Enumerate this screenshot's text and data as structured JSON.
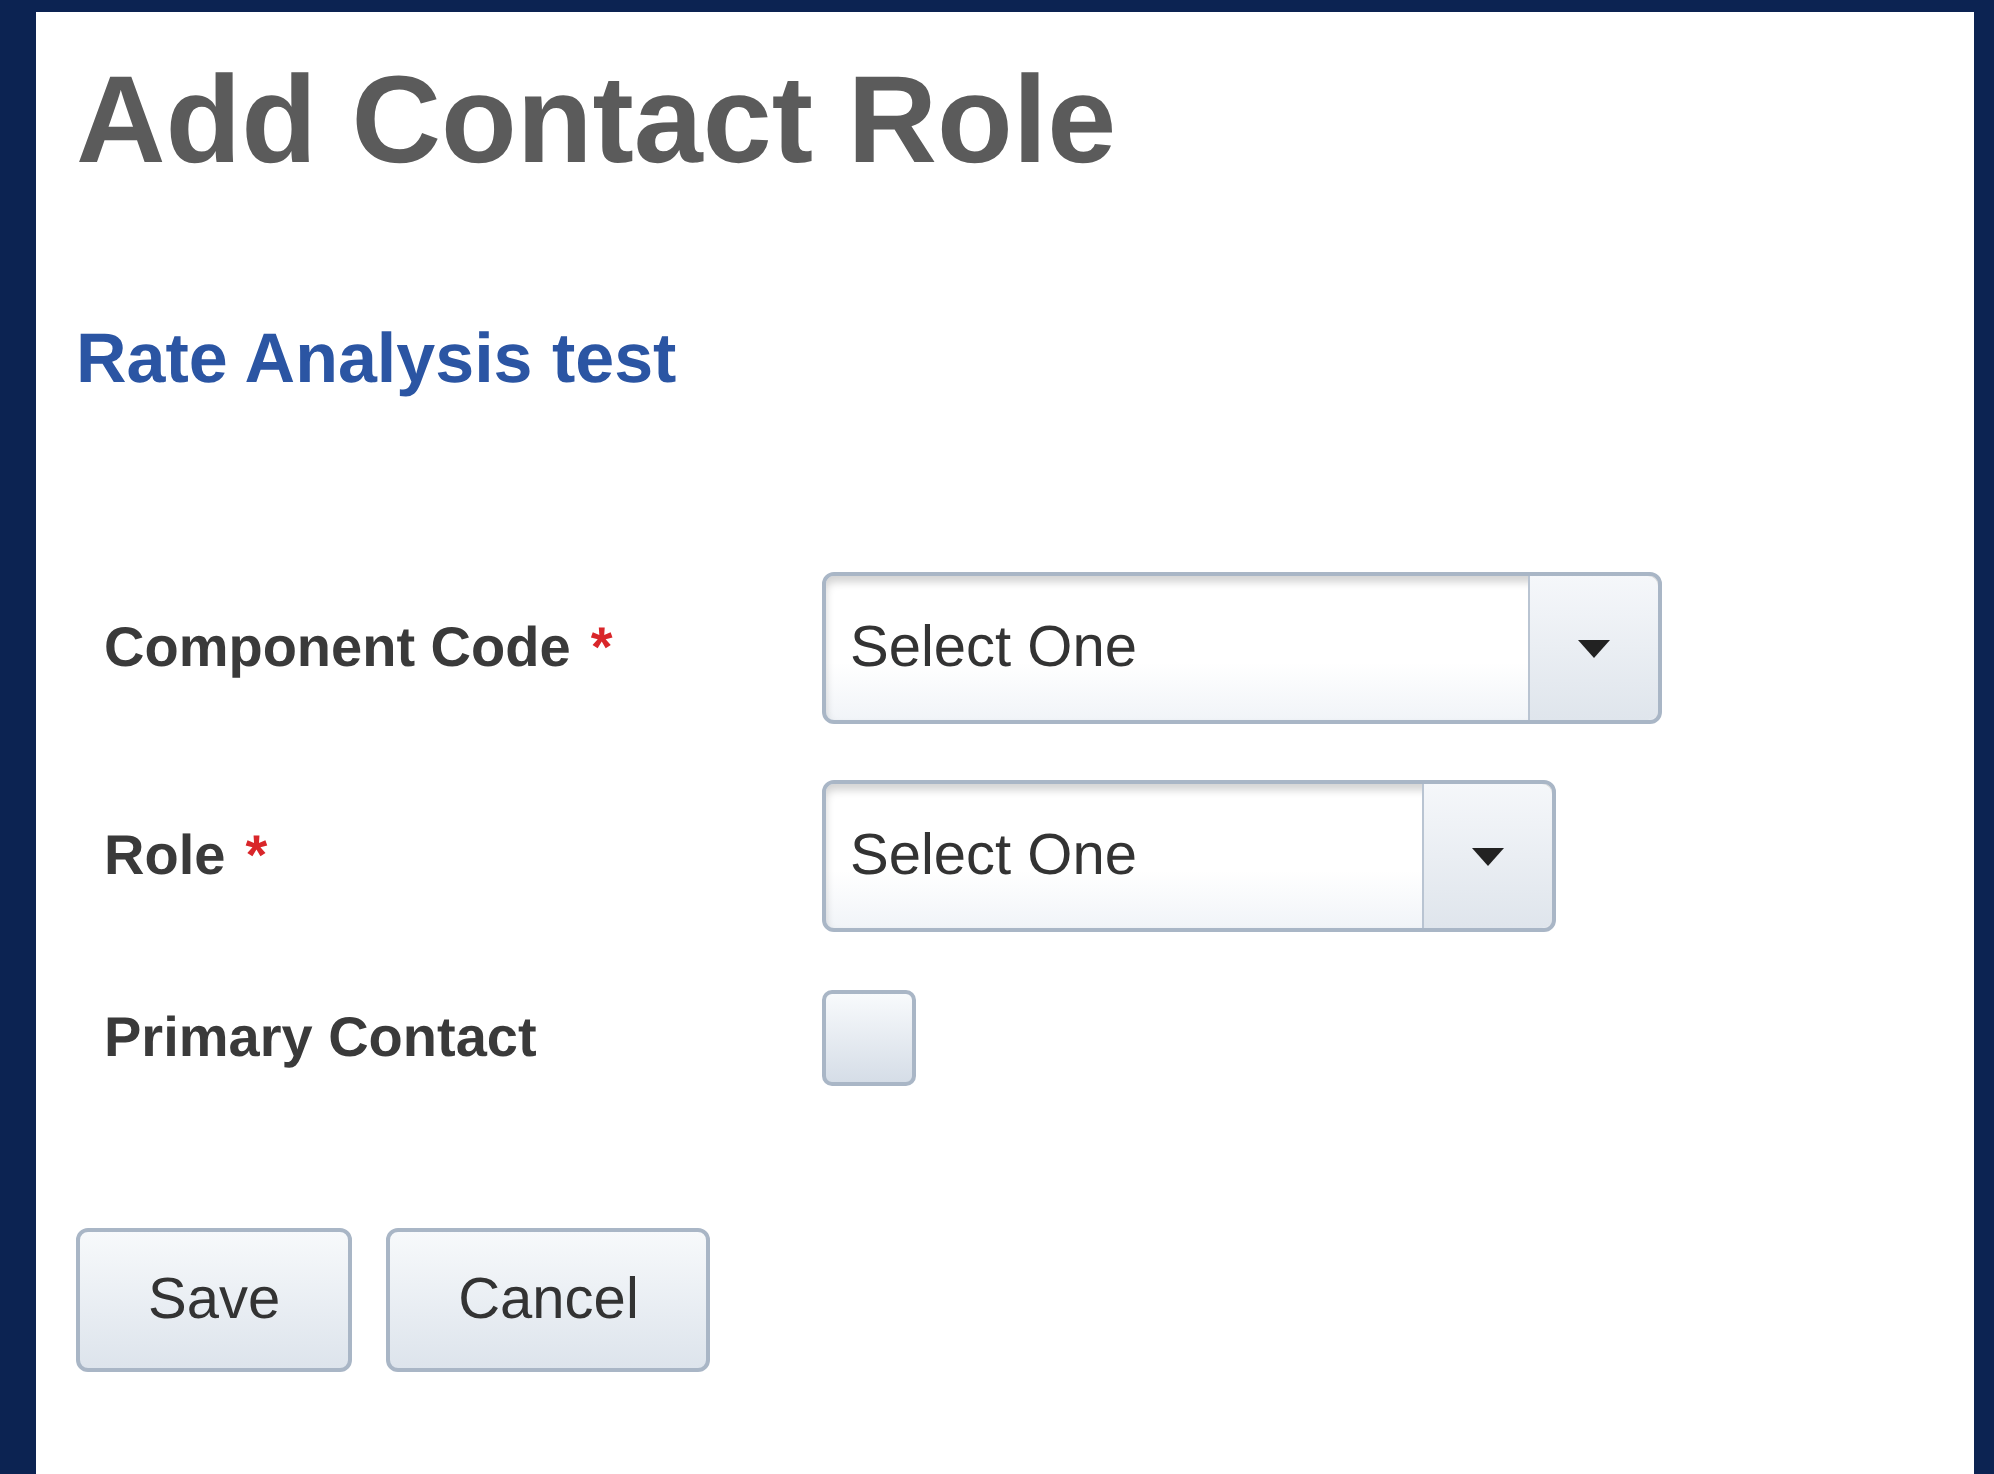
{
  "title": "Add Contact Role",
  "subtitle": "Rate Analysis test",
  "fields": [
    {
      "kind": "select",
      "label": "Component Code",
      "required_mark": "*",
      "value": "Select One"
    },
    {
      "kind": "select",
      "label": "Role",
      "required_mark": "*",
      "value": "Select One"
    },
    {
      "kind": "checkbox",
      "label": "Primary Contact",
      "checked": false
    }
  ],
  "buttons": [
    "Save",
    "Cancel"
  ]
}
